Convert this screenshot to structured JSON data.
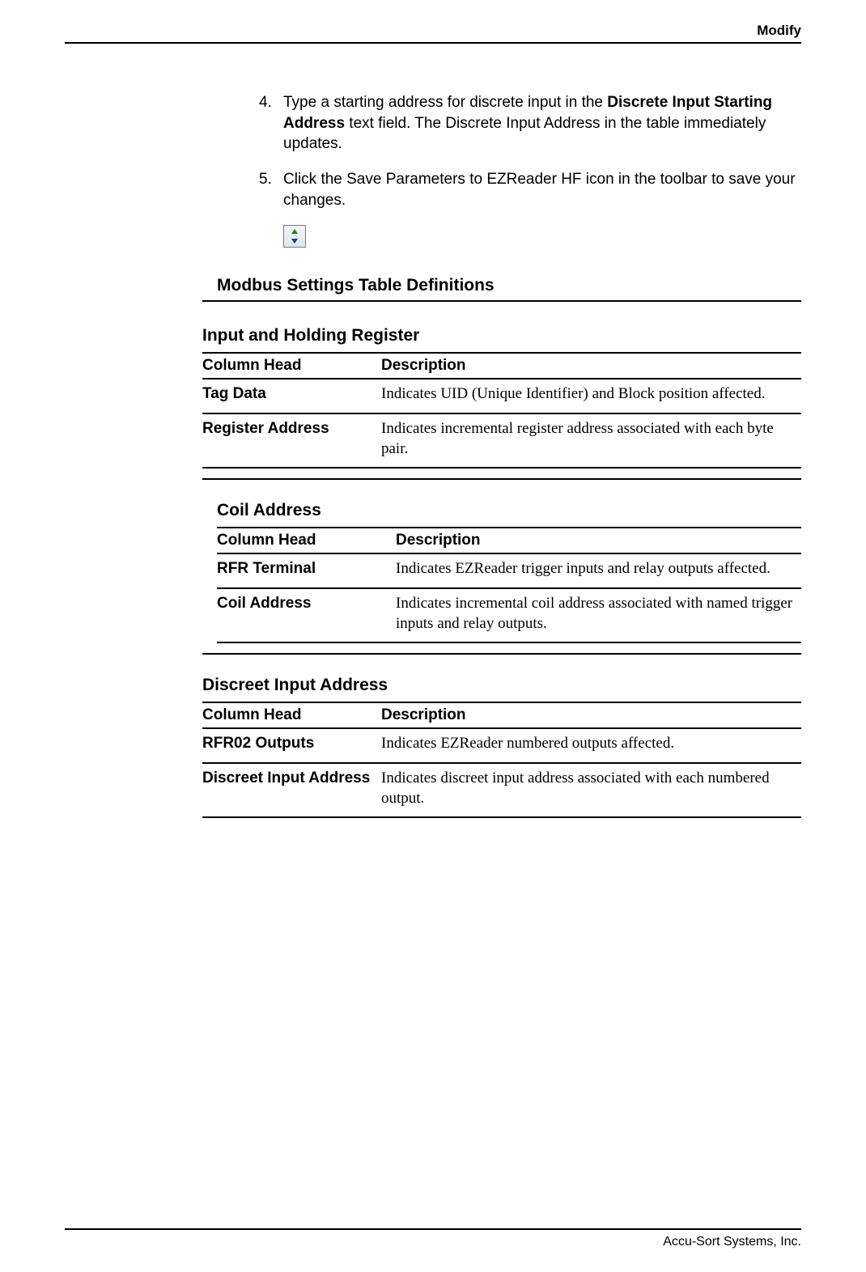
{
  "header": {
    "title": "Modify"
  },
  "steps": [
    {
      "num": "4.",
      "text_pre": "Type a starting address for discrete input in the ",
      "bold": "Discrete Input Starting Address",
      "text_post": " text field. The Discrete Input Address in the table immediately updates."
    },
    {
      "num": "5.",
      "text_pre": "Click the Save Parameters to EZReader HF icon in the toolbar to save your changes.",
      "bold": "",
      "text_post": ""
    }
  ],
  "sections": {
    "main_heading": "Modbus Settings Table Definitions",
    "tables": [
      {
        "title": "Input and Holding Register",
        "head_col": "Column Head",
        "head_desc": "Description",
        "rows": [
          {
            "col": "Tag Data",
            "desc": "Indicates UID (Unique Identifier) and Block position affected."
          },
          {
            "col": "Register Address",
            "desc": "Indicates incremental register address associated with each byte pair."
          }
        ]
      },
      {
        "title": "Coil Address",
        "head_col": "Column Head",
        "head_desc": "Description",
        "rows": [
          {
            "col": "RFR Terminal",
            "desc": "Indicates EZReader trigger inputs and relay outputs affected."
          },
          {
            "col": "Coil Address",
            "desc": "Indicates incremental coil address associated with named trigger inputs and relay outputs."
          }
        ]
      },
      {
        "title": "Discreet Input Address",
        "head_col": "Column Head",
        "head_desc": "Description",
        "rows": [
          {
            "col": "RFR02 Outputs",
            "desc": "Indicates EZReader numbered outputs affected."
          },
          {
            "col": "Discreet Input Address",
            "desc": "Indicates discreet input address associated with each numbered output."
          }
        ]
      }
    ]
  },
  "footer": {
    "company": "Accu-Sort Systems, Inc."
  }
}
